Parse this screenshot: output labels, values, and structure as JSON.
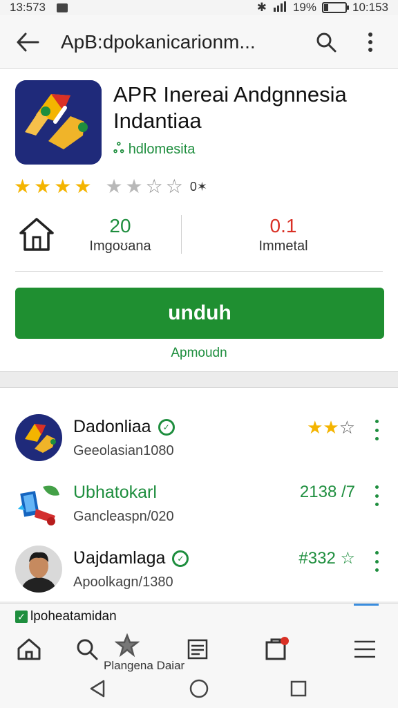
{
  "status_bar": {
    "time": "13:573",
    "battery": "19%",
    "clock_right": "10:153"
  },
  "app_bar": {
    "title": "ApB:dpokanicarionm..."
  },
  "app": {
    "name": "APR Inereai Andgnnesia Indantiaa",
    "developer": "hdlomesita",
    "rating_stars": 4,
    "rating_text": "0✶",
    "stats": [
      {
        "value": "20",
        "label": "Imgoʊana",
        "color": "#1e8e3e"
      },
      {
        "value": "0.1",
        "label": "Immetal",
        "color": "#d93025"
      }
    ],
    "install_label": "unduh",
    "secondary_link": "Apmoudn"
  },
  "related": [
    {
      "name": "Dadonliaa",
      "meta": "Geeolasian1080",
      "right": "",
      "stars_filled": 2,
      "verified": true,
      "green_name": false
    },
    {
      "name": "Ubhatokarl",
      "meta": "Gancleaspn/020",
      "right": "2138 /7",
      "stars_filled": 0,
      "verified": false,
      "green_name": true
    },
    {
      "name": "Ʋajdamlaga",
      "meta": "Apoolkagn/1380",
      "right": "#332 ☆",
      "stars_filled": 0,
      "verified": true,
      "green_name": false
    }
  ],
  "bottom_nav": {
    "snack_text": "lpoheatamidan",
    "label": "Plangena Daiar"
  },
  "colors": {
    "accent": "#1f8f31",
    "star": "#f4b400",
    "link": "#1e8e3e"
  }
}
